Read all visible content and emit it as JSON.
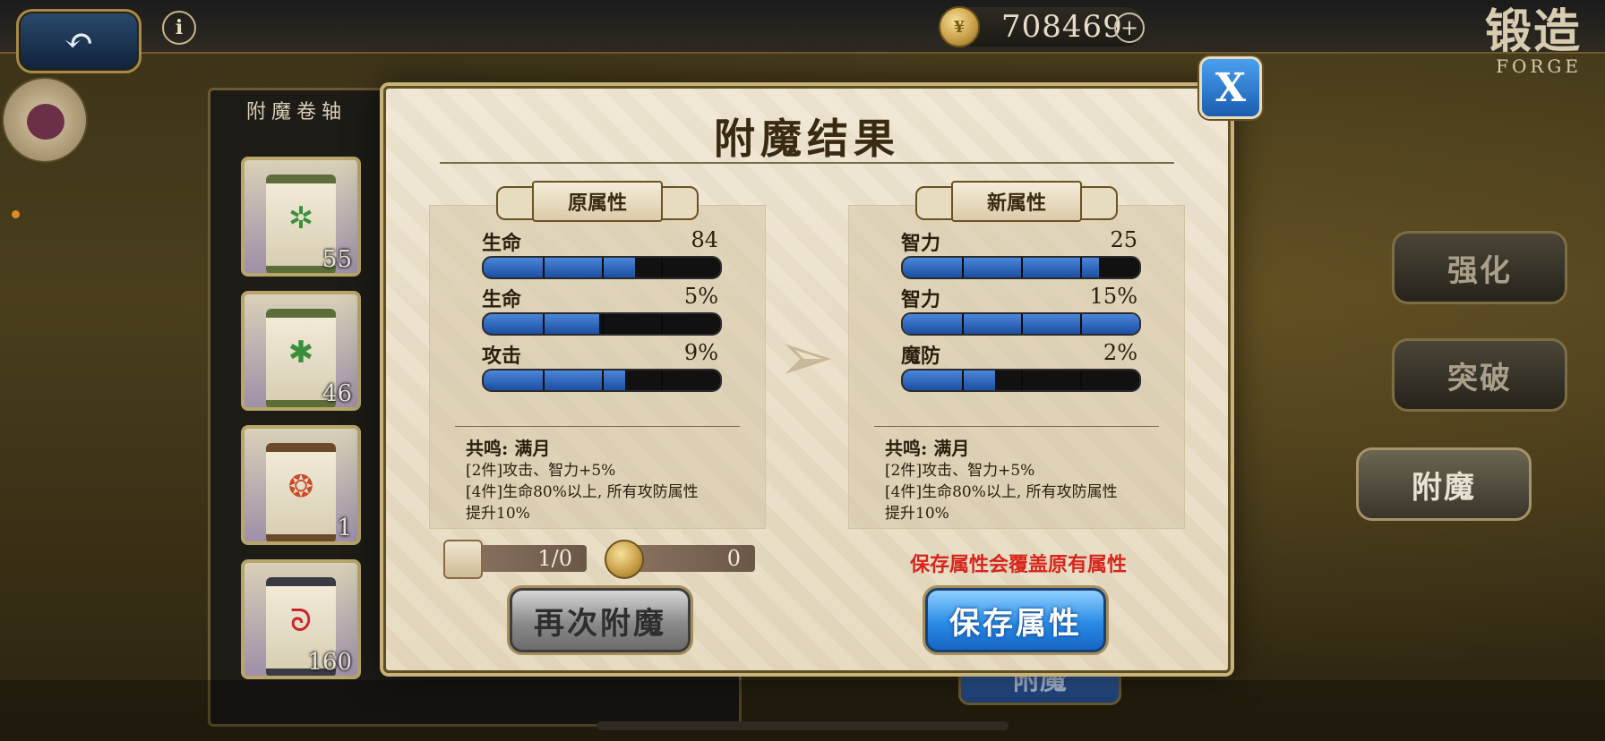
{
  "topbar": {
    "back_icon": "back-arrow-icon",
    "info_icon": "info-icon",
    "currency_amount": "708469",
    "plus_label": "+",
    "forge_title_cn": "锻造",
    "forge_title_en": "FORGE"
  },
  "scroll_panel": {
    "title": "附魔卷轴",
    "items": [
      {
        "count": "55",
        "color": "#3a8f3a"
      },
      {
        "count": "46",
        "color": "#3a8f3a"
      },
      {
        "count": "1",
        "color": "#c84a2a"
      },
      {
        "count": "160",
        "color": "#c8242a"
      }
    ]
  },
  "side_buttons": {
    "strengthen": "强化",
    "breakthrough": "突破",
    "enchant": "附魔"
  },
  "behind_button": "附魔",
  "modal": {
    "title": "附魔结果",
    "close_label": "X",
    "original": {
      "label": "原属性",
      "stats": [
        {
          "name": "生命",
          "value": "84",
          "fill": 0.64
        },
        {
          "name": "生命",
          "value": "5%",
          "fill": 0.49
        },
        {
          "name": "攻击",
          "value": "9%",
          "fill": 0.6
        }
      ],
      "resonance_title": "共鸣: 满月",
      "resonance_lines": [
        "[2件]攻击、智力+5%",
        "[4件]生命80%以上, 所有攻防属性",
        "提升10%"
      ]
    },
    "new": {
      "label": "新属性",
      "stats": [
        {
          "name": "智力",
          "value": "25",
          "fill": 0.83
        },
        {
          "name": "智力",
          "value": "15%",
          "fill": 1.0
        },
        {
          "name": "魔防",
          "value": "2%",
          "fill": 0.39
        }
      ],
      "resonance_title": "共鸣: 满月",
      "resonance_lines": [
        "[2件]攻击、智力+5%",
        "[4件]生命80%以上, 所有攻防属性",
        "提升10%"
      ]
    },
    "cost_scroll": "1/0",
    "cost_gold": "0",
    "warning": "保存属性会覆盖原有属性",
    "reenchant_label": "再次附魔",
    "save_label": "保存属性"
  }
}
